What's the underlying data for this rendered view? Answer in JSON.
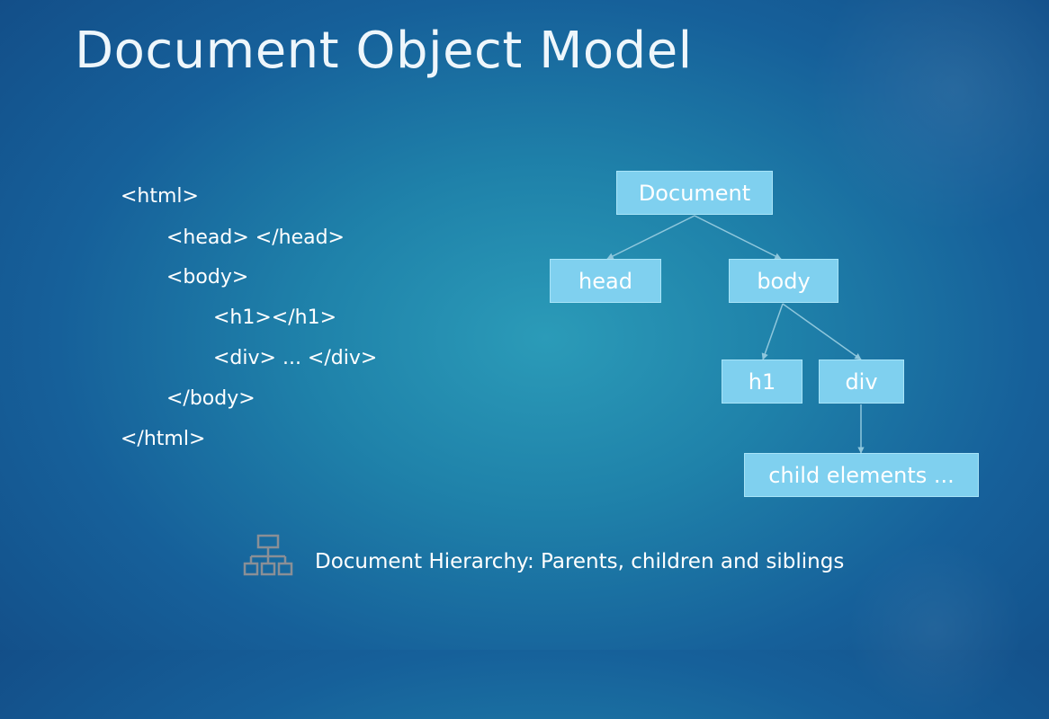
{
  "title": "Document Object Model",
  "code_lines": [
    "<html>",
    "<head> </head>",
    "<body>",
    "<h1></h1>",
    "<div> ... </div>",
    "</body>",
    "</html>"
  ],
  "tree": {
    "root": "Document",
    "head": "head",
    "body": "body",
    "h1": "h1",
    "div": "div",
    "children": "child elements ..."
  },
  "caption": {
    "icon": "hierarchy-icon",
    "text": "Document Hierarchy: Parents, children and siblings"
  },
  "colors": {
    "node_fill": "#7fd0ef",
    "connector": "#8fc7dc"
  }
}
